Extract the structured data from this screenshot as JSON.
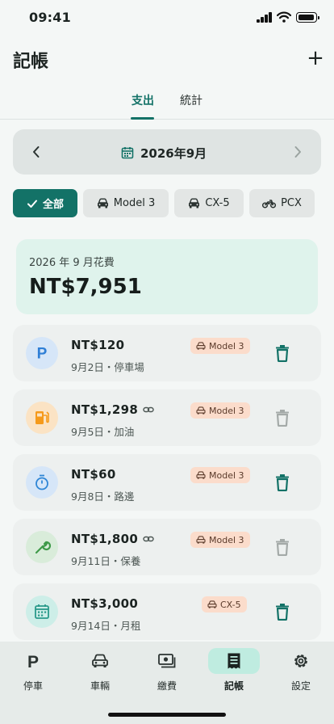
{
  "status": {
    "time": "09:41"
  },
  "header": {
    "title": "記帳",
    "add_label": "+"
  },
  "tabs": [
    {
      "label": "支出"
    },
    {
      "label": "統計"
    }
  ],
  "month": {
    "label": "2026年9月"
  },
  "filters": [
    {
      "label": "全部"
    },
    {
      "label": "Model 3"
    },
    {
      "label": "CX-5"
    },
    {
      "label": "PCX"
    }
  ],
  "summary": {
    "label": "2026 年 9 月花費",
    "total": "NT$7,951"
  },
  "expenses": [
    {
      "amount": "NT$120",
      "meta": "9月2日・停車場",
      "vehicle": "Model 3",
      "linked": false,
      "icon": "parking-icon",
      "icon_color": "#2f7fd6",
      "icon_bg": "#d6e6f8"
    },
    {
      "amount": "NT$1,298",
      "meta": "9月5日・加油",
      "vehicle": "Model 3",
      "linked": true,
      "icon": "fuel-icon",
      "icon_color": "#f59a1b",
      "icon_bg": "#fbe3c4"
    },
    {
      "amount": "NT$60",
      "meta": "9月8日・路邊",
      "vehicle": "Model 3",
      "linked": false,
      "icon": "timer-icon",
      "icon_color": "#2f86d6",
      "icon_bg": "#d6e6f8"
    },
    {
      "amount": "NT$1,800",
      "meta": "9月11日・保養",
      "vehicle": "Model 3",
      "linked": true,
      "icon": "wrench-icon",
      "icon_color": "#3f9a4a",
      "icon_bg": "#d9ecda"
    },
    {
      "amount": "NT$3,000",
      "meta": "9月14日・月租",
      "vehicle": "CX-5",
      "linked": false,
      "icon": "calendar-icon",
      "icon_color": "#2a9a8a",
      "icon_bg": "#cdeee8"
    }
  ],
  "nav": [
    {
      "label": "停車",
      "icon": "parking-icon"
    },
    {
      "label": "車輛",
      "icon": "car-icon"
    },
    {
      "label": "繳費",
      "icon": "payment-icon"
    },
    {
      "label": "記帳",
      "icon": "receipt-icon"
    },
    {
      "label": "設定",
      "icon": "gear-icon"
    }
  ],
  "colors": {
    "accent": "#137267",
    "badge": "#fbdccb",
    "summary_bg": "#dff3ec"
  }
}
